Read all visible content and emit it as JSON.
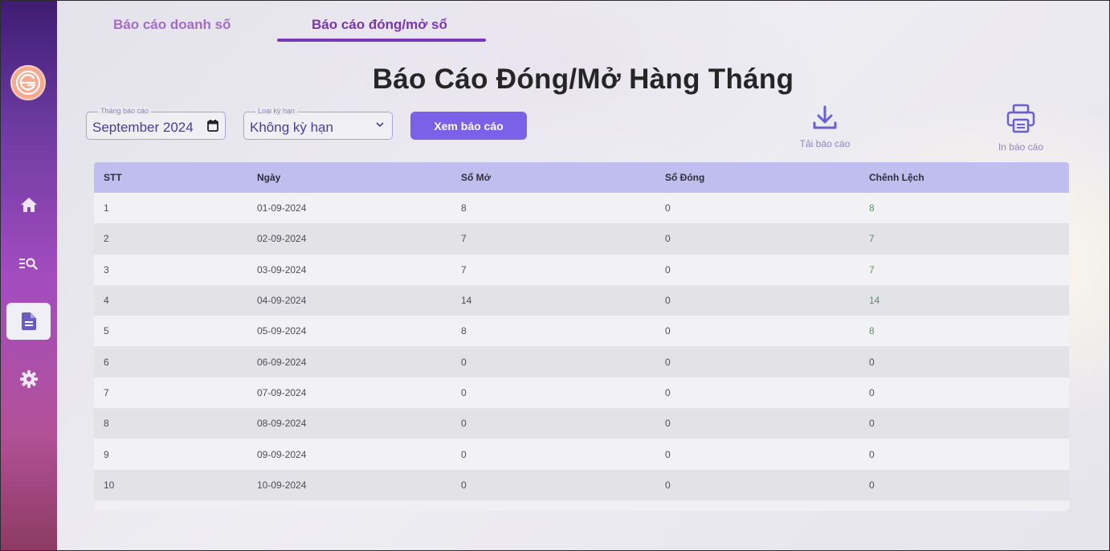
{
  "sidebar": {
    "items": [
      {
        "icon": "home-icon",
        "active": false
      },
      {
        "icon": "search-list-icon",
        "active": false
      },
      {
        "icon": "document-icon",
        "active": true
      },
      {
        "icon": "gear-icon",
        "active": false
      }
    ]
  },
  "tabs": [
    {
      "label": "Báo cáo doanh số",
      "active": false
    },
    {
      "label": "Báo cáo đóng/mở sổ",
      "active": true
    }
  ],
  "page_title": "Báo Cáo Đóng/Mở Hàng Tháng",
  "filters": {
    "month_legend": "Tháng báo cáo",
    "month_value": "September 2024",
    "type_legend": "Loại kỳ hạn",
    "type_value": "Không kỳ hạn"
  },
  "actions": {
    "view_label": "Xem báo cáo",
    "download_label": "Tải báo cáo",
    "print_label": "In báo cáo"
  },
  "colors": {
    "accent": "#7b61e8",
    "header_row": "#c0bdef",
    "positive": "#4e9a5a"
  },
  "table": {
    "headers": [
      "STT",
      "Ngày",
      "Sổ Mở",
      "Sổ Đóng",
      "Chênh Lệch"
    ],
    "rows": [
      [
        "1",
        "01-09-2024",
        "8",
        "0",
        "8"
      ],
      [
        "2",
        "02-09-2024",
        "7",
        "0",
        "7"
      ],
      [
        "3",
        "03-09-2024",
        "7",
        "0",
        "7"
      ],
      [
        "4",
        "04-09-2024",
        "14",
        "0",
        "14"
      ],
      [
        "5",
        "05-09-2024",
        "8",
        "0",
        "8"
      ],
      [
        "6",
        "06-09-2024",
        "0",
        "0",
        "0"
      ],
      [
        "7",
        "07-09-2024",
        "0",
        "0",
        "0"
      ],
      [
        "8",
        "08-09-2024",
        "0",
        "0",
        "0"
      ],
      [
        "9",
        "09-09-2024",
        "0",
        "0",
        "0"
      ],
      [
        "10",
        "10-09-2024",
        "0",
        "0",
        "0"
      ]
    ]
  }
}
